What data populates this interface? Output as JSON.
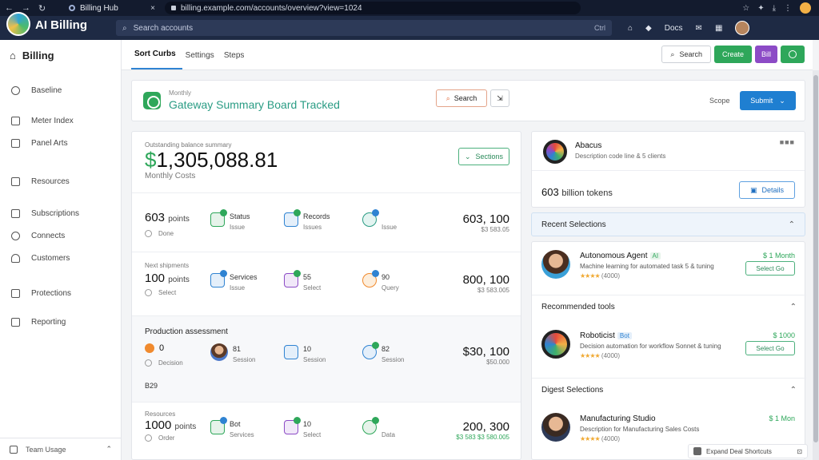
{
  "browser": {
    "tab_title": "Billing Hub",
    "url": "billing.example.com/accounts/overview?view=1024",
    "menu_label": "⋮"
  },
  "app": {
    "name": "AI Billing",
    "search_placeholder": "Search accounts",
    "search_shortcut": "Ctrl",
    "header_link": "Docs"
  },
  "sidebar": {
    "title": "Billing",
    "items": [
      {
        "label": "Baseline",
        "icon": "clock-icon"
      },
      {
        "label": "Meter Index",
        "icon": "square-icon"
      },
      {
        "label": "Panel Arts",
        "icon": "edit-icon"
      },
      {
        "label": "Resources",
        "icon": "box-icon"
      },
      {
        "label": "Subscriptions",
        "icon": "columns-icon"
      },
      {
        "label": "Connects",
        "icon": "gear-icon"
      },
      {
        "label": "Customers",
        "icon": "user-icon"
      },
      {
        "label": "Protections",
        "icon": "shield-icon"
      },
      {
        "label": "Reporting",
        "icon": "building-icon"
      }
    ],
    "footer_label": "Team Usage"
  },
  "tabs": [
    {
      "label": "Sort Curbs",
      "active": true
    },
    {
      "label": "Settings",
      "active": false
    },
    {
      "label": "Steps",
      "active": false
    }
  ],
  "toolbar": {
    "search_label": "Search",
    "primary_label": "Create",
    "secondary_label": "Bill"
  },
  "hero": {
    "caption": "Monthly",
    "title": "Gateway Summary Board Tracked",
    "search_label": "Search",
    "meta_label": "Scope",
    "primary_label": "Submit"
  },
  "summary": {
    "caption": "Outstanding balance summary",
    "currency": "$",
    "amount": "1,305,088.81",
    "subtitle": "Monthly Costs",
    "action_label": "Sections"
  },
  "rows": [
    {
      "caption": "",
      "value": "603",
      "unit": "points",
      "status": "Done",
      "mini": [
        {
          "label": "Status",
          "sub": "Issue",
          "icon": "document-icon",
          "color": "#2ea75a"
        },
        {
          "label": "Records",
          "sub": "Issues",
          "icon": "truck-icon",
          "color": "#2f83d2"
        },
        {
          "label": "",
          "sub": "Issue",
          "icon": "chat-icon",
          "color": "#2ea75a"
        }
      ],
      "right_big": "603, 100",
      "right_small": "$3 583.05",
      "right_small_green": false
    },
    {
      "caption": "Next shipments",
      "value": "100",
      "unit": "points",
      "status": "Select",
      "mini": [
        {
          "label": "Services",
          "sub": "Issue",
          "icon": "checklist-icon",
          "color": "#2f83d2"
        },
        {
          "label": "55",
          "sub": "Select",
          "icon": "report-icon",
          "color": "#8c4bc6"
        },
        {
          "label": "90",
          "sub": "Query",
          "icon": "chart-icon",
          "color": "#f08a2e"
        }
      ],
      "right_big": "800, 100",
      "right_small": "$3 583.005",
      "right_small_green": false
    }
  ],
  "section": {
    "title": "Production assessment",
    "value": "0",
    "status": "Decision",
    "mini": [
      {
        "label": "81",
        "sub": "Session",
        "icon": "face-icon",
        "color": "#b6855e"
      },
      {
        "label": "10",
        "sub": "Session",
        "icon": "folder-icon",
        "color": "#2f83d2"
      },
      {
        "label": "82",
        "sub": "Session",
        "icon": "search-icon",
        "color": "#2f83d2"
      }
    ],
    "right_big": "$30, 100",
    "right_small": "$50.000",
    "footer": "B29"
  },
  "last_row": {
    "caption": "Resources",
    "value": "1000",
    "unit": "points",
    "status": "Order",
    "mini": [
      {
        "label": "Bot",
        "sub": "Services",
        "icon": "network-icon",
        "color": "#2ea75a"
      },
      {
        "label": "10",
        "sub": "Select",
        "icon": "layers-icon",
        "color": "#8c4bc6"
      },
      {
        "label": "",
        "sub": "Data",
        "icon": "tools-icon",
        "color": "#2ea75a"
      }
    ],
    "right_big": "200, 300",
    "right_small": "$3 583 $3 580.005",
    "right_small_green": true
  },
  "right": {
    "account_name": "Abacus",
    "account_desc": "Description code line & 5 clients",
    "kebab": "■■■",
    "tokens_value": "603",
    "tokens_unit": "billion tokens",
    "tokens_action": "Details",
    "section1": "Recent Selections",
    "item1": {
      "name": "Autonomous Agent",
      "tag": "AI",
      "desc": "Machine learning for automated task 5 & tuning",
      "rating": "(4000)",
      "price": "$ 1 Month",
      "action": "Select Go"
    },
    "section2": "Recommended tools",
    "item2": {
      "name": "Roboticist",
      "tag": "Bot",
      "desc": "Decision automation for workflow Sonnet & tuning",
      "rating": "(4000)",
      "price": "$ 1000",
      "action": "Select Go"
    },
    "section3": "Digest Selections",
    "item3": {
      "name": "Manufacturing Studio",
      "desc": "Description for Manufacturing Sales Costs",
      "rating": "(4000)",
      "price": "$ 1 Mon"
    },
    "toast": "Expand Deal Shortcuts"
  }
}
